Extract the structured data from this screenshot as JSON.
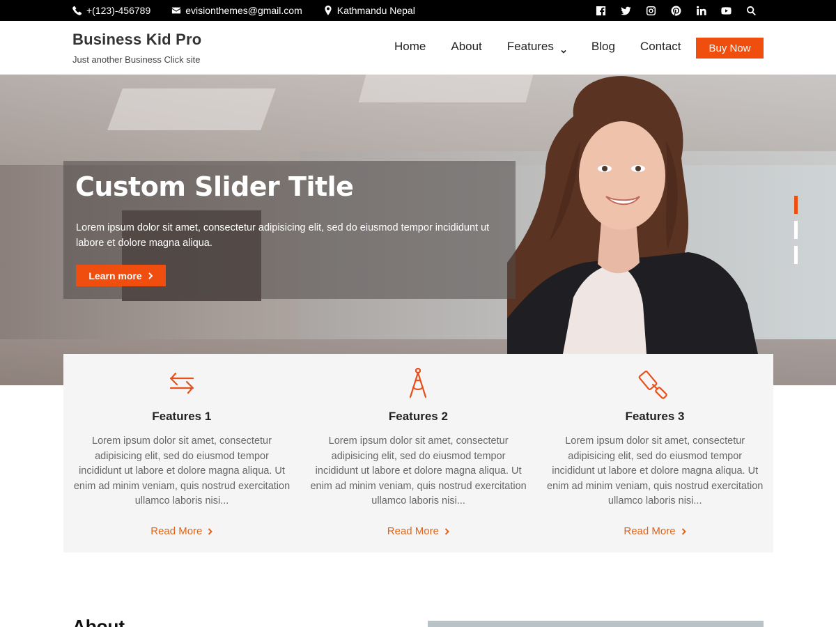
{
  "topbar": {
    "phone": "+(123)-456789",
    "email": "evisionthemes@gmail.com",
    "location": "Kathmandu Nepal",
    "social_icons": [
      "facebook-icon",
      "twitter-icon",
      "instagram-icon",
      "pinterest-icon",
      "linkedin-icon",
      "youtube-icon",
      "search-icon"
    ]
  },
  "header": {
    "site_title": "Business Kid Pro",
    "tagline": "Just another Business Click site",
    "nav": [
      "Home",
      "About",
      "Features",
      "Blog",
      "Contact"
    ],
    "buy_label": "Buy Now"
  },
  "hero": {
    "title": "Custom Slider Title",
    "text": "Lorem ipsum dolor sit amet, consectetur adipisicing elit, sed do eiusmod tempor incididunt ut labore et dolore magna aliqua.",
    "button_label": "Learn more",
    "active_slide": 1,
    "slide_count": 3
  },
  "features": [
    {
      "title": "Features 1",
      "icon": "exchange-arrows-icon",
      "text": "Lorem ipsum dolor sit amet, consectetur adipisicing elit, sed do eiusmod tempor incididunt ut labore et dolore magna aliqua. Ut enim ad minim veniam, quis nostrud exercitation ullamco laboris nisi...",
      "link": "Read More"
    },
    {
      "title": "Features 2",
      "icon": "compass-drafting-icon",
      "text": "Lorem ipsum dolor sit amet, consectetur adipisicing elit, sed do eiusmod tempor incididunt ut labore et dolore magna aliqua. Ut enim ad minim veniam, quis nostrud exercitation ullamco laboris nisi...",
      "link": "Read More"
    },
    {
      "title": "Features 3",
      "icon": "paint-roller-icon",
      "text": "Lorem ipsum dolor sit amet, consectetur adipisicing elit, sed do eiusmod tempor incididunt ut labore et dolore magna aliqua. Ut enim ad minim veniam, quis nostrud exercitation ullamco laboris nisi...",
      "link": "Read More"
    }
  ],
  "about": {
    "heading": "About"
  },
  "colors": {
    "accent": "#f04e0f",
    "topbar_bg": "#000000",
    "features_bg": "#f5f5f5"
  }
}
